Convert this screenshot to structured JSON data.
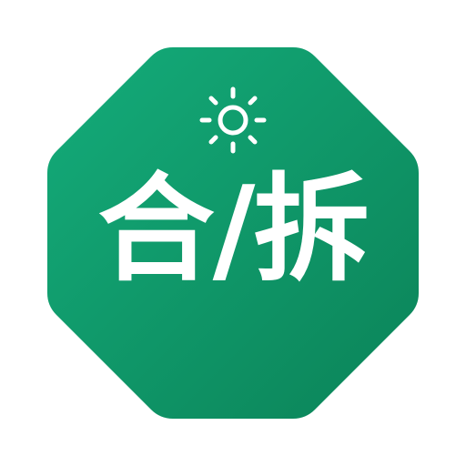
{
  "app_icon": {
    "label": "合/拆",
    "symbol": "sun-icon",
    "colors": {
      "background_start": "#14ac7a",
      "background_end": "#0b8358",
      "foreground": "#ffffff"
    }
  }
}
